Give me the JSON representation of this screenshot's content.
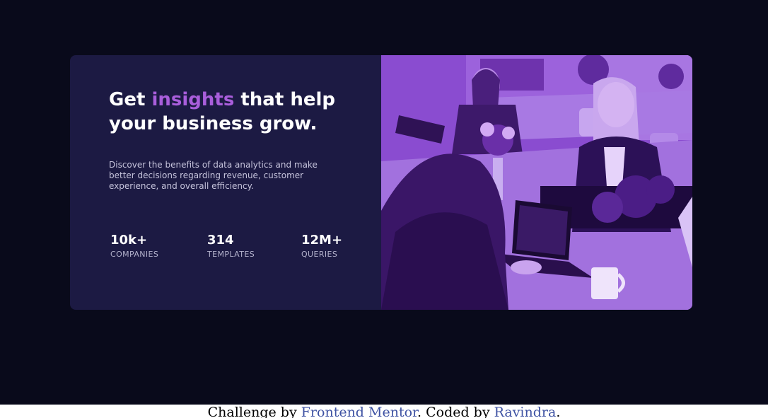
{
  "card": {
    "headline": {
      "prefix": "Get ",
      "highlight": "insights",
      "suffix": " that help your business grow."
    },
    "description": "Discover the benefits of data analytics and make better decisions regarding revenue, customer experience, and overall efficiency.",
    "stats": [
      {
        "value": "10k+",
        "label": "COMPANIES"
      },
      {
        "value": "314",
        "label": "TEMPLATES"
      },
      {
        "value": "12M+",
        "label": "QUERIES"
      }
    ]
  },
  "footer": {
    "text_before": "Challenge by ",
    "link1": "Frontend Mentor",
    "text_middle": ". Coded by ",
    "link2": "Ravindra",
    "text_after": "."
  },
  "colors": {
    "page_background": "#090a1b",
    "card_background": "#1c1a43",
    "accent": "#a95edb",
    "image_overlay": "#8d4fd3",
    "link": "#3e52a3"
  }
}
